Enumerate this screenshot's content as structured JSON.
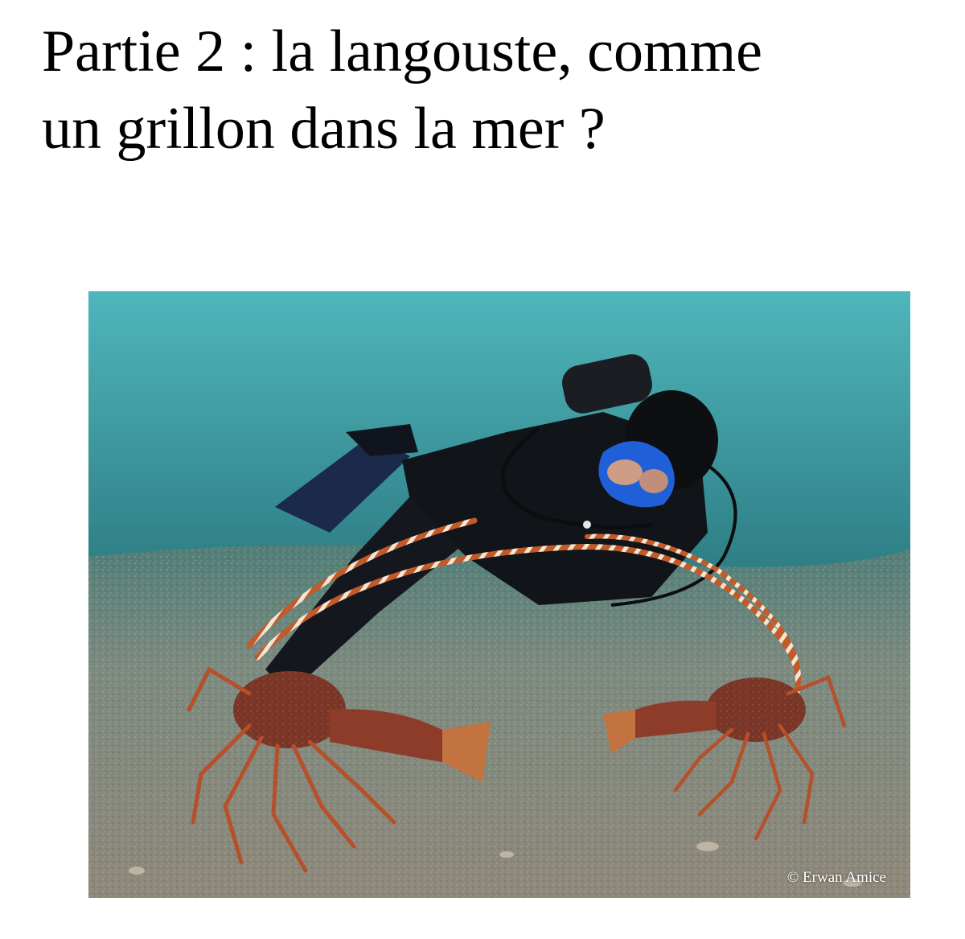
{
  "page": {
    "title_line_1": "Partie 2 : la langouste, comme",
    "title_line_2": "un grillon dans la mer ?"
  },
  "photo": {
    "credit": "© Erwan Amice",
    "subjects": [
      "scuba-diver",
      "spiny-lobster",
      "spiny-lobster"
    ],
    "colors": {
      "water": "#3a9aa2",
      "sand": "#8a8a7c",
      "diver_suit": "#111418",
      "mask": "#1f5fd8",
      "lobster": "#8a3a24"
    }
  }
}
